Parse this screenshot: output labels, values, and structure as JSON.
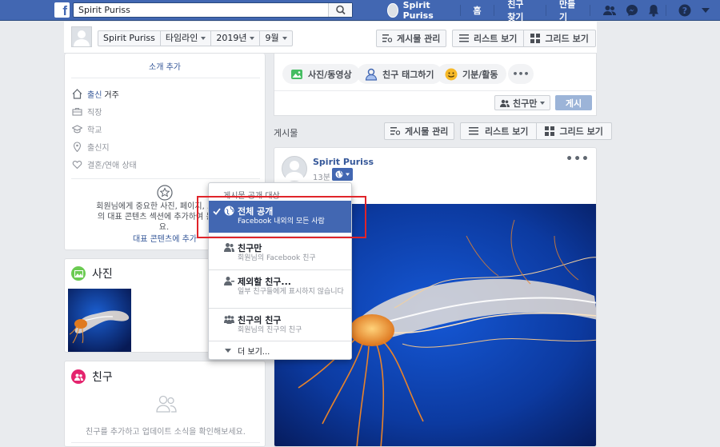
{
  "topbar": {
    "logo": "f",
    "search_value": "Spirit Puriss",
    "user_name": "Spirit Puriss",
    "nav_home": "홈",
    "nav_find_friends": "친구 찾기",
    "nav_create": "만들기",
    "icons": [
      "friends-requests-icon",
      "messenger-icon",
      "notifications-icon",
      "help-icon",
      "account-menu-icon"
    ]
  },
  "subheader": {
    "crumbs": [
      "Spirit Puriss",
      "타임라인",
      "2019년",
      "9월"
    ],
    "manage_posts": "게시물 관리",
    "list_view": "리스트 보기",
    "grid_view": "그리드 보기"
  },
  "intro": {
    "add_bio": "소개 추가",
    "items": [
      {
        "highlight": "출신",
        "text": "거주"
      },
      {
        "highlight": "",
        "text": "직장"
      },
      {
        "highlight": "",
        "text": "학교"
      },
      {
        "highlight": "",
        "text": "출신지"
      },
      {
        "highlight": "",
        "text": "결혼/연애 상태"
      }
    ],
    "featured_text_1": "회원님에게 중요한 사진, 페이지, 그룹 등",
    "featured_text_2": "의 대표 콘텐츠 섹션에 추가하여 눈에 띄",
    "featured_text_3": "요.",
    "featured_link": "대표 콘텐츠에 추가"
  },
  "photos": {
    "title": "사진"
  },
  "friends": {
    "title": "친구",
    "empty_text": "친구를 추가하고 업데이트 소식을 확인해보세요."
  },
  "composer": {
    "photo_video": "사진/동영상",
    "tag_friends": "친구 태그하기",
    "feeling": "기분/활동",
    "more": "•••",
    "audience": "친구만",
    "post_button": "게시"
  },
  "posts_section": {
    "label": "게시물",
    "manage_posts": "게시물 관리",
    "list_view": "리스트 보기",
    "grid_view": "그리드 보기"
  },
  "post": {
    "author": "Spirit Puriss",
    "time": "13분",
    "more": "•••"
  },
  "audience_menu": {
    "header": "게시물 공개 대상",
    "options": [
      {
        "title": "전체 공개",
        "desc": "Facebook 내외의 모든 사람",
        "icon": "globe-icon",
        "selected": true
      },
      {
        "title": "친구만",
        "desc": "회원님의 Facebook 친구",
        "icon": "friends-icon",
        "selected": false
      },
      {
        "title": "제외할 친구...",
        "desc": "일부 친구들에게 표시하지 않습니다",
        "icon": "friends-except-icon",
        "selected": false
      },
      {
        "title": "친구의 친구",
        "desc": "회원님의 친구의 친구",
        "icon": "friends-of-friends-icon",
        "selected": false
      }
    ],
    "see_more": "더 보기..."
  },
  "colors": {
    "brand_blue": "#4267b2",
    "highlight_red": "#e0242a"
  }
}
